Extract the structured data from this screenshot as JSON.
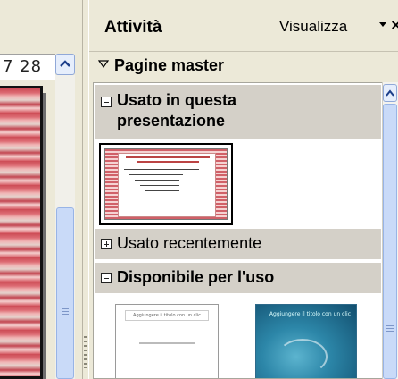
{
  "ruler": {
    "text": "7 28"
  },
  "task_pane": {
    "title": "Attività",
    "view_menu_label": "Visualizza",
    "close_symbol": "×",
    "section": {
      "title": "Pagine master",
      "toggle_icon": "triangle-down-icon"
    },
    "groups": [
      {
        "label": "Usato in questa presentazione",
        "state": "expanded",
        "toggle_icon": "minus-box-icon"
      },
      {
        "label": "Usato recentemente",
        "state": "collapsed",
        "toggle_icon": "plus-box-icon"
      },
      {
        "label": "Disponibile per l'uso",
        "state": "expanded",
        "toggle_icon": "minus-box-icon"
      }
    ],
    "available_thumbnails": [
      {
        "caption": "Aggiungere il titolo con un clic"
      },
      {
        "caption": "Aggiungere il titolo con un clic"
      }
    ]
  },
  "colors": {
    "pane_background": "#ece9d8",
    "group_header": "#d4d0c8",
    "scrollbar_thumb": "#c9daf8"
  }
}
